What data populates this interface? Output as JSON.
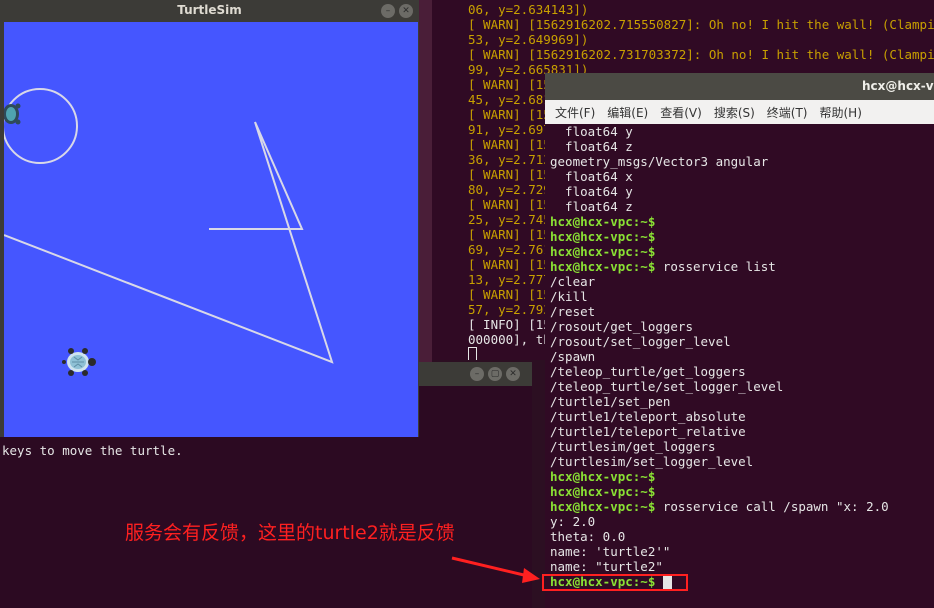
{
  "turtlesim": {
    "title": "TurtleSim",
    "min_label": "–",
    "close_label": "✕"
  },
  "warn_terminal": {
    "lines": [
      {
        "text": "06, y=2.634143])",
        "kind": "warn"
      },
      {
        "text": "[ WARN] [1562916202.715550827]: Oh no! I hit the wall! (Clampin",
        "kind": "warn"
      },
      {
        "text": "53, y=2.649969])",
        "kind": "warn"
      },
      {
        "text": "[ WARN] [1562916202.731703372]: Oh no! I hit the wall! (Clampin",
        "kind": "warn"
      },
      {
        "text": "99, y=2.665831])",
        "kind": "warn"
      },
      {
        "text": "[ WARN] [15",
        "kind": "warn"
      },
      {
        "text": "45, y=2.681",
        "kind": "warn"
      },
      {
        "text": "[ WARN] [15",
        "kind": "warn"
      },
      {
        "text": "91, y=2.697",
        "kind": "warn"
      },
      {
        "text": "[ WARN] [15",
        "kind": "warn"
      },
      {
        "text": "36, y=2.713",
        "kind": "warn"
      },
      {
        "text": "[ WARN] [15",
        "kind": "warn"
      },
      {
        "text": "80, y=2.729",
        "kind": "warn"
      },
      {
        "text": "[ WARN] [15",
        "kind": "warn"
      },
      {
        "text": "25, y=2.745",
        "kind": "warn"
      },
      {
        "text": "[ WARN] [15",
        "kind": "warn"
      },
      {
        "text": "69, y=2.761",
        "kind": "warn"
      },
      {
        "text": "[ WARN] [15",
        "kind": "warn"
      },
      {
        "text": "13, y=2.777",
        "kind": "warn"
      },
      {
        "text": "[ WARN] [15",
        "kind": "warn"
      },
      {
        "text": "57, y=2.793",
        "kind": "warn"
      },
      {
        "text": "[ INFO] [15",
        "kind": "info"
      },
      {
        "text": "000000], th",
        "kind": "info"
      }
    ]
  },
  "teleop_terminal": {
    "min_label": "–",
    "max_label": "▢",
    "close_label": "✕",
    "lines": [
      "-------------------",
      "keys to move the turtle."
    ]
  },
  "main_terminal": {
    "title": "hcx@hcx-vpc",
    "menu": [
      "文件(F)",
      "编辑(E)",
      "查看(V)",
      "搜索(S)",
      "终端(T)",
      "帮助(H)"
    ],
    "prompt": "hcx@hcx-vpc:~$",
    "lines": [
      {
        "p": "",
        "t": "  float64 y"
      },
      {
        "p": "",
        "t": "  float64 z"
      },
      {
        "p": "",
        "t": "geometry_msgs/Vector3 angular"
      },
      {
        "p": "",
        "t": "  float64 x"
      },
      {
        "p": "",
        "t": "  float64 y"
      },
      {
        "p": "",
        "t": "  float64 z"
      },
      {
        "p": "",
        "t": ""
      },
      {
        "p": "hcx@hcx-vpc:~$",
        "t": ""
      },
      {
        "p": "hcx@hcx-vpc:~$",
        "t": ""
      },
      {
        "p": "hcx@hcx-vpc:~$",
        "t": ""
      },
      {
        "p": "hcx@hcx-vpc:~$",
        "t": " rosservice list"
      },
      {
        "p": "",
        "t": "/clear"
      },
      {
        "p": "",
        "t": "/kill"
      },
      {
        "p": "",
        "t": "/reset"
      },
      {
        "p": "",
        "t": "/rosout/get_loggers"
      },
      {
        "p": "",
        "t": "/rosout/set_logger_level"
      },
      {
        "p": "",
        "t": "/spawn"
      },
      {
        "p": "",
        "t": "/teleop_turtle/get_loggers"
      },
      {
        "p": "",
        "t": "/teleop_turtle/set_logger_level"
      },
      {
        "p": "",
        "t": "/turtle1/set_pen"
      },
      {
        "p": "",
        "t": "/turtle1/teleport_absolute"
      },
      {
        "p": "",
        "t": "/turtle1/teleport_relative"
      },
      {
        "p": "",
        "t": "/turtlesim/get_loggers"
      },
      {
        "p": "",
        "t": "/turtlesim/set_logger_level"
      },
      {
        "p": "hcx@hcx-vpc:~$",
        "t": ""
      },
      {
        "p": "hcx@hcx-vpc:~$",
        "t": ""
      },
      {
        "p": "hcx@hcx-vpc:~$",
        "t": " rosservice call /spawn \"x: 2.0"
      },
      {
        "p": "",
        "t": "y: 2.0"
      },
      {
        "p": "",
        "t": "theta: 0.0"
      },
      {
        "p": "",
        "t": "name: 'turtle2'\""
      },
      {
        "p": "",
        "t": "name: \"turtle2\""
      },
      {
        "p": "hcx@hcx-vpc:~$",
        "t": " "
      }
    ]
  },
  "annotation": {
    "text": "服务会有反馈，这里的turtle2就是反馈",
    "color": "#ff2020"
  },
  "colors": {
    "canvas": "#4556ff",
    "terminal_bg": "#300a24",
    "prompt": "#8ae234",
    "warn": "#c8a000"
  }
}
